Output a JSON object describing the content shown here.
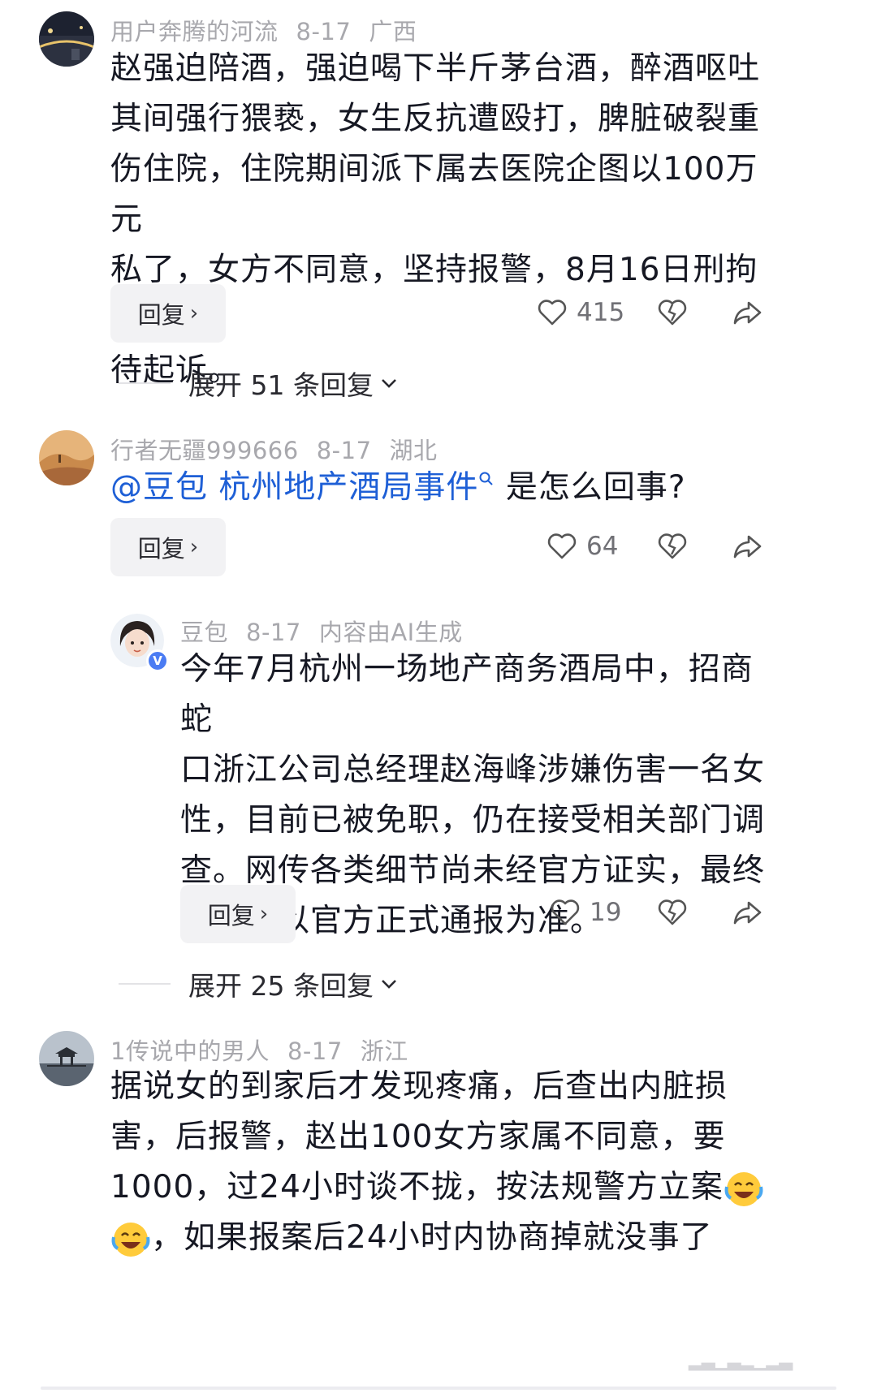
{
  "comments": [
    {
      "username": "用户奔腾的河流",
      "date": "8-17",
      "location": "广西",
      "text_lines": [
        "赵强迫陪酒，强迫喝下半斤茅台酒，醉酒呕吐",
        "其间强行猥亵，女生反抗遭殴打，脾脏破裂重",
        "伤住院，住院期间派下属去医院企图以100万元",
        "私了，女方不同意，坚持报警，8月16日刑拘等",
        "待起诉。"
      ],
      "reply_label": "回复",
      "likes": "415",
      "expand_label": "展开 51 条回复"
    },
    {
      "username": "行者无疆999666",
      "date": "8-17",
      "location": "湖北",
      "mention": "@豆包",
      "topic": "杭州地产酒局事件",
      "topic_search_icon": "search-icon",
      "question": "是怎么回事?",
      "reply_label": "回复",
      "likes": "64"
    },
    {
      "username": "豆包",
      "date": "8-17",
      "tag": "内容由AI生成",
      "verified_badge": "V",
      "text_lines": [
        "今年7月杭州一场地产商务酒局中，招商蛇",
        "口浙江公司总经理赵海峰涉嫌伤害一名女",
        "性，目前已被免职，仍在接受相关部门调",
        "查。网传各类细节尚未经官方证实，最终",
        "情况请以官方正式通报为准。"
      ],
      "reply_label": "回复",
      "likes": "19",
      "expand_label": "展开 25 条回复"
    },
    {
      "username": "1传说中的男人",
      "date": "8-17",
      "location": "浙江",
      "text_lines": [
        "据说女的到家后才发现疼痛，后查出内脏损",
        "害，后报警，赵出100女方家属不同意，要",
        "1000，过24小时谈不拢，按法规警方立案",
        "，如果报案后24小时内协商掉就没事了"
      ],
      "emoji": "laughing-crying-emoji"
    }
  ],
  "colors": {
    "meta": "#a8a8ad",
    "text": "#161823",
    "mention": "#1e5fd6",
    "button_bg": "#f2f2f4",
    "verified": "#4b7cf3"
  }
}
